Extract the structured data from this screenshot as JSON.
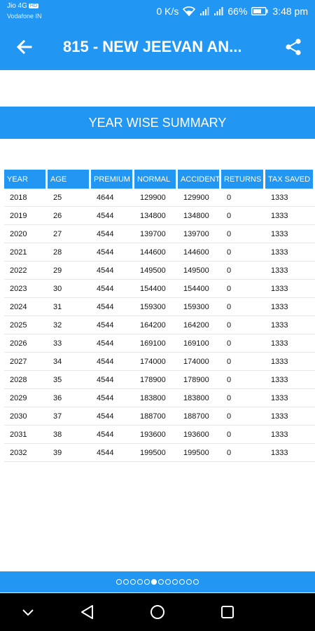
{
  "status_bar": {
    "carrier_primary": "Jio 4G",
    "carrier_badge": "HD",
    "carrier_secondary": "Vodafone IN",
    "speed": "0 K/s",
    "battery": "66%",
    "time": "3:48 pm"
  },
  "app_bar": {
    "title": "815 - NEW JEEVAN AN..."
  },
  "summary": {
    "heading": "YEAR WISE SUMMARY"
  },
  "table": {
    "headers": [
      "YEAR",
      "AGE",
      "PREMIUM",
      "NORMAL",
      "ACCIDENT",
      "RETURNS",
      "TAX SAVED"
    ],
    "rows": [
      [
        "2018",
        "25",
        "4644",
        "129900",
        "129900",
        "0",
        "1333"
      ],
      [
        "2019",
        "26",
        "4544",
        "134800",
        "134800",
        "0",
        "1333"
      ],
      [
        "2020",
        "27",
        "4544",
        "139700",
        "139700",
        "0",
        "1333"
      ],
      [
        "2021",
        "28",
        "4544",
        "144600",
        "144600",
        "0",
        "1333"
      ],
      [
        "2022",
        "29",
        "4544",
        "149500",
        "149500",
        "0",
        "1333"
      ],
      [
        "2023",
        "30",
        "4544",
        "154400",
        "154400",
        "0",
        "1333"
      ],
      [
        "2024",
        "31",
        "4544",
        "159300",
        "159300",
        "0",
        "1333"
      ],
      [
        "2025",
        "32",
        "4544",
        "164200",
        "164200",
        "0",
        "1333"
      ],
      [
        "2026",
        "33",
        "4544",
        "169100",
        "169100",
        "0",
        "1333"
      ],
      [
        "2027",
        "34",
        "4544",
        "174000",
        "174000",
        "0",
        "1333"
      ],
      [
        "2028",
        "35",
        "4544",
        "178900",
        "178900",
        "0",
        "1333"
      ],
      [
        "2029",
        "36",
        "4544",
        "183800",
        "183800",
        "0",
        "1333"
      ],
      [
        "2030",
        "37",
        "4544",
        "188700",
        "188700",
        "0",
        "1333"
      ],
      [
        "2031",
        "38",
        "4544",
        "193600",
        "193600",
        "0",
        "1333"
      ],
      [
        "2032",
        "39",
        "4544",
        "199500",
        "199500",
        "0",
        "1333"
      ]
    ]
  },
  "pager": {
    "total_pages": 12,
    "active_index": 5
  },
  "icons": {
    "back": "arrow-back-icon",
    "share": "share-icon",
    "wifi": "wifi-icon",
    "signal": "signal-icon",
    "battery": "battery-icon",
    "nav_down": "chevron-down-icon",
    "nav_back": "triangle-back-icon",
    "nav_home": "circle-home-icon",
    "nav_recents": "square-recents-icon"
  },
  "colors": {
    "primary": "#2196f3",
    "nav_background": "#000000"
  }
}
